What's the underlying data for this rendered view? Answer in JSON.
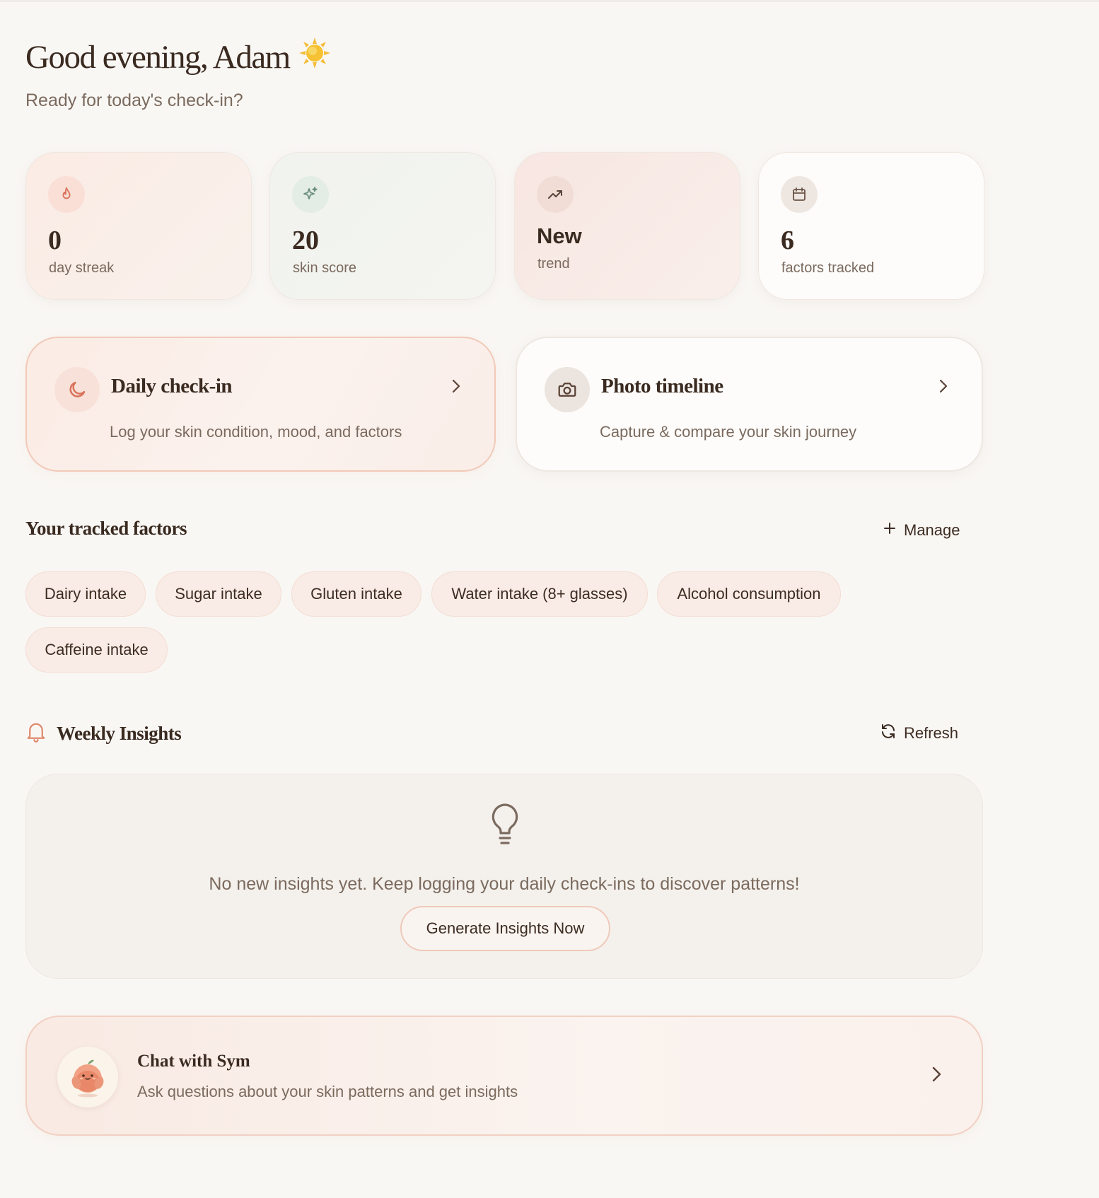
{
  "header": {
    "greeting": "Good evening, Adam",
    "greeting_icon": "sun-icon",
    "subtitle": "Ready for today's check-in?"
  },
  "stats": [
    {
      "icon": "flame-icon",
      "value": "0",
      "label": "day streak",
      "accent": "#d9725a"
    },
    {
      "icon": "sparkles-icon",
      "value": "20",
      "label": "skin score",
      "accent": "#6b8f7c"
    },
    {
      "icon": "trending-up-icon",
      "value": "New",
      "label": "trend",
      "accent": "#5a4236"
    },
    {
      "icon": "calendar-icon",
      "value": "6",
      "label": "factors tracked",
      "accent": "#6a5446"
    }
  ],
  "actions": {
    "checkin": {
      "icon": "moon-icon",
      "title": "Daily check-in",
      "description": "Log your skin condition, mood, and factors"
    },
    "photos": {
      "icon": "camera-icon",
      "title": "Photo timeline",
      "description": "Capture & compare your skin journey"
    }
  },
  "factors": {
    "title": "Your tracked factors",
    "manage_label": "Manage",
    "items": [
      "Dairy intake",
      "Sugar intake",
      "Gluten intake",
      "Water intake (8+ glasses)",
      "Alcohol consumption",
      "Caffeine intake"
    ]
  },
  "insights": {
    "title": "Weekly Insights",
    "refresh_label": "Refresh",
    "empty_message": "No new insights yet. Keep logging your daily check-ins to discover patterns!",
    "generate_label": "Generate Insights Now"
  },
  "chat": {
    "title": "Chat with Sym",
    "description": "Ask questions about your skin patterns and get insights"
  },
  "colors": {
    "background": "#f9f7f4",
    "text_primary": "#3a2a20",
    "text_secondary": "#7b6a5e",
    "accent_peach": "#f2d0c3",
    "accent_orange": "#e08a6e"
  }
}
